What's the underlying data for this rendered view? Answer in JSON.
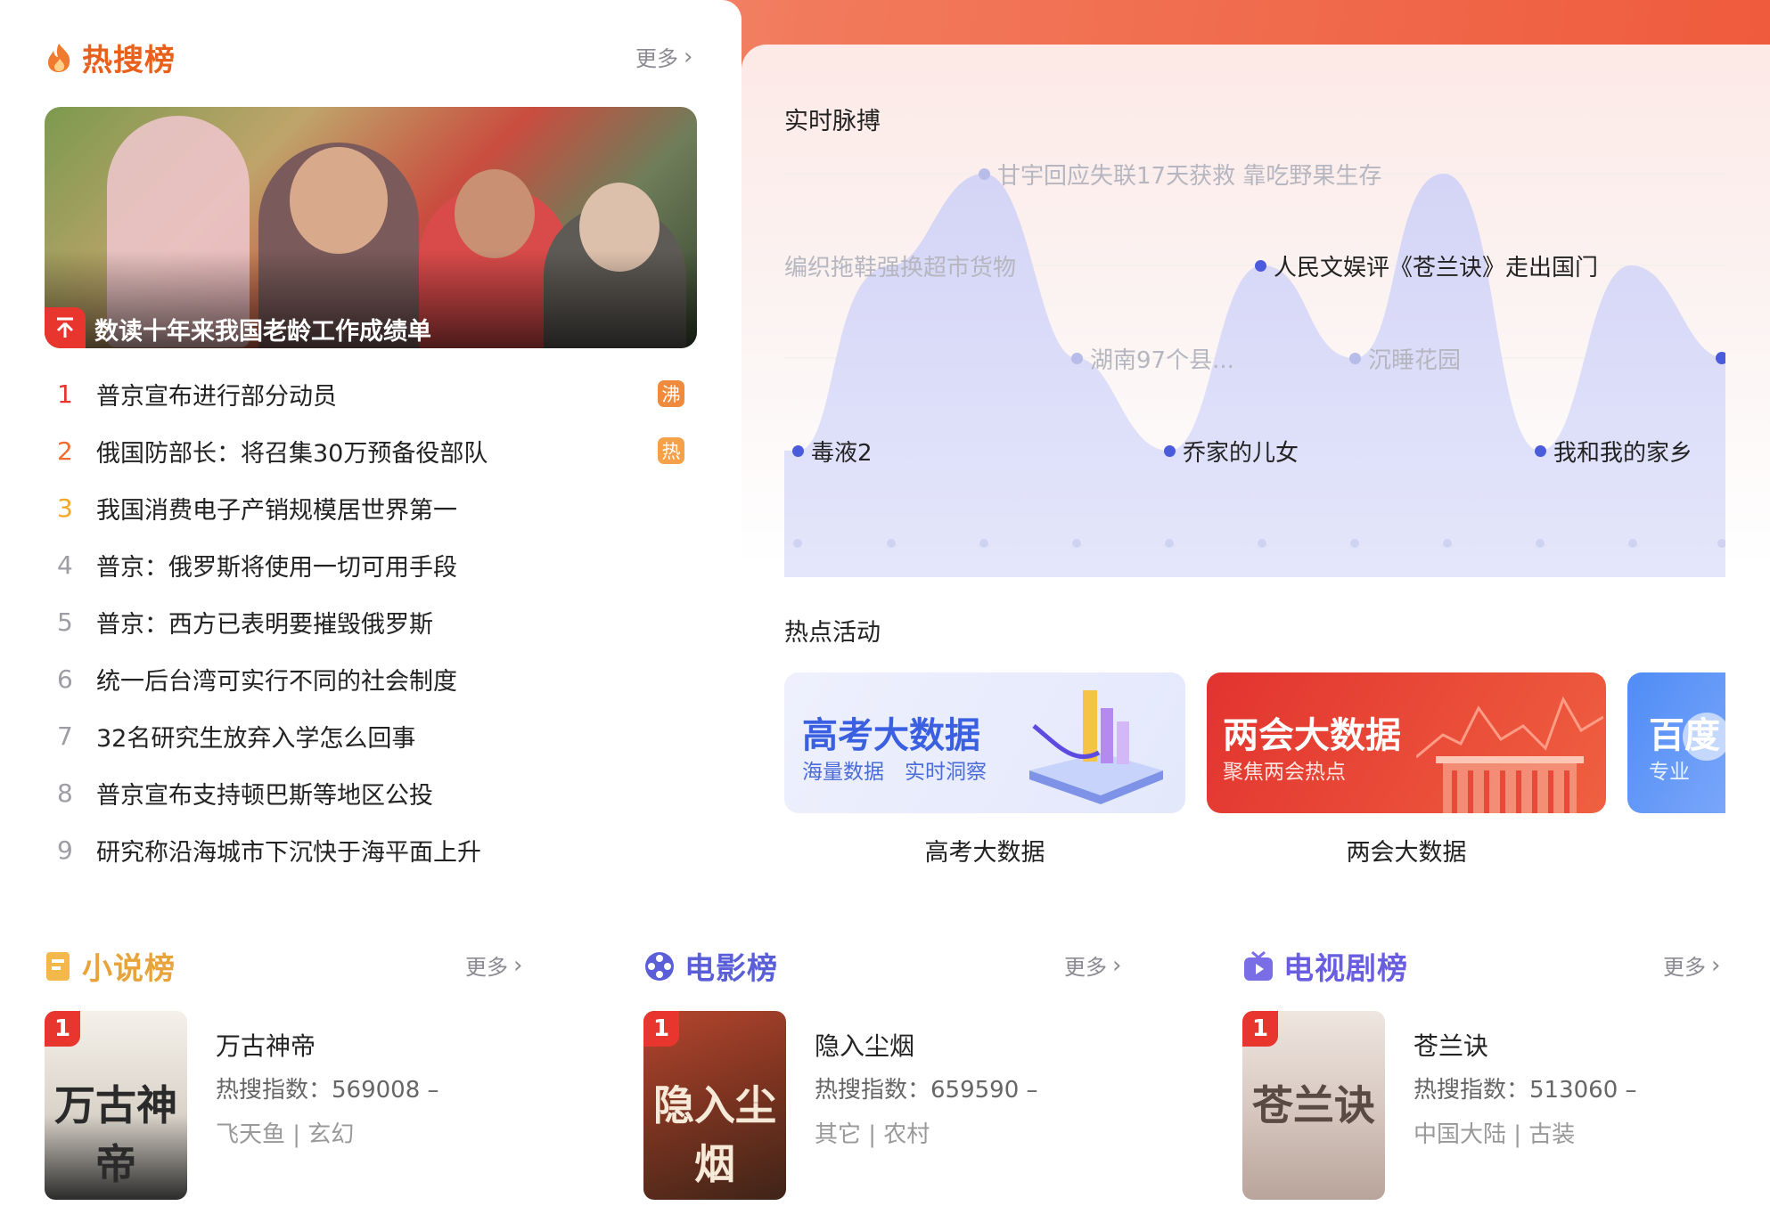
{
  "colors": {
    "hot_orange": "#e8601c",
    "rank1": "#e8352e",
    "rank2": "#f26a2b",
    "rank3": "#f5a623",
    "badge_boil": "#f08a3c",
    "badge_hot": "#f5a14a",
    "novel_title": "#e8a43a",
    "movie_title": "#5a5fd8",
    "tv_title": "#6a5ee0",
    "pulse_fill": "#dcdcf8",
    "pulse_dot": "#4a5bdc"
  },
  "hot_search": {
    "icon": "flame-icon",
    "title": "热搜榜",
    "more": "更多",
    "hero_caption": "数读十年来我国老龄工作成绩单",
    "items": [
      {
        "rank": "1",
        "text": "普京宣布进行部分动员",
        "badge": "沸"
      },
      {
        "rank": "2",
        "text": "俄国防部长：将召集30万预备役部队",
        "badge": "热"
      },
      {
        "rank": "3",
        "text": "我国消费电子产销规模居世界第一",
        "badge": ""
      },
      {
        "rank": "4",
        "text": "普京：俄罗斯将使用一切可用手段",
        "badge": ""
      },
      {
        "rank": "5",
        "text": "普京：西方已表明要摧毁俄罗斯",
        "badge": ""
      },
      {
        "rank": "6",
        "text": "统一后台湾可实行不同的社会制度",
        "badge": ""
      },
      {
        "rank": "7",
        "text": "32名研究生放弃入学怎么回事",
        "badge": ""
      },
      {
        "rank": "8",
        "text": "普京宣布支持顿巴斯等地区公投",
        "badge": ""
      },
      {
        "rank": "9",
        "text": "研究称沿海城市下沉快于海平面上升",
        "badge": ""
      }
    ]
  },
  "pulse": {
    "title": "实时脉搏",
    "labels": [
      {
        "text": "甘宇回应失联17天获救 靠吃野果生存",
        "faded": true
      },
      {
        "text": "编织拖鞋强换超市货物",
        "faded": true
      },
      {
        "text": "人民文娱评《苍兰诀》走出国门",
        "faded": false
      },
      {
        "text": "湖南97个县...",
        "faded": true
      },
      {
        "text": "沉睡花园",
        "faded": true
      },
      {
        "text": "毒液2",
        "faded": false
      },
      {
        "text": "乔家的儿女",
        "faded": false
      },
      {
        "text": "我和我的家乡",
        "faded": false
      }
    ]
  },
  "activities": {
    "title": "热点活动",
    "cards": [
      {
        "title": "高考大数据",
        "subtitle": "海量数据　实时洞察",
        "caption": "高考大数据"
      },
      {
        "title": "两会大数据",
        "subtitle": "聚焦两会热点",
        "caption": "两会大数据"
      },
      {
        "title": "百度",
        "subtitle": "专业",
        "caption": ""
      }
    ]
  },
  "rankings": [
    {
      "icon": "book-icon",
      "title": "小说榜",
      "more": "更多",
      "top": {
        "rank": "1",
        "cover_text": "万古神帝",
        "name": "万古神帝",
        "index_label": "热搜指数：",
        "index_value": "569008",
        "trend": "–",
        "tags": "飞天鱼 | 玄幻"
      }
    },
    {
      "icon": "film-reel-icon",
      "title": "电影榜",
      "more": "更多",
      "top": {
        "rank": "1",
        "cover_text": "隐入尘烟",
        "name": "隐入尘烟",
        "index_label": "热搜指数：",
        "index_value": "659590",
        "trend": "–",
        "tags": "其它 | 农村"
      }
    },
    {
      "icon": "tv-icon",
      "title": "电视剧榜",
      "more": "更多",
      "top": {
        "rank": "1",
        "cover_text": "苍兰诀",
        "name": "苍兰诀",
        "index_label": "热搜指数：",
        "index_value": "513060",
        "trend": "–",
        "tags": "中国大陆 | 古装"
      }
    }
  ]
}
